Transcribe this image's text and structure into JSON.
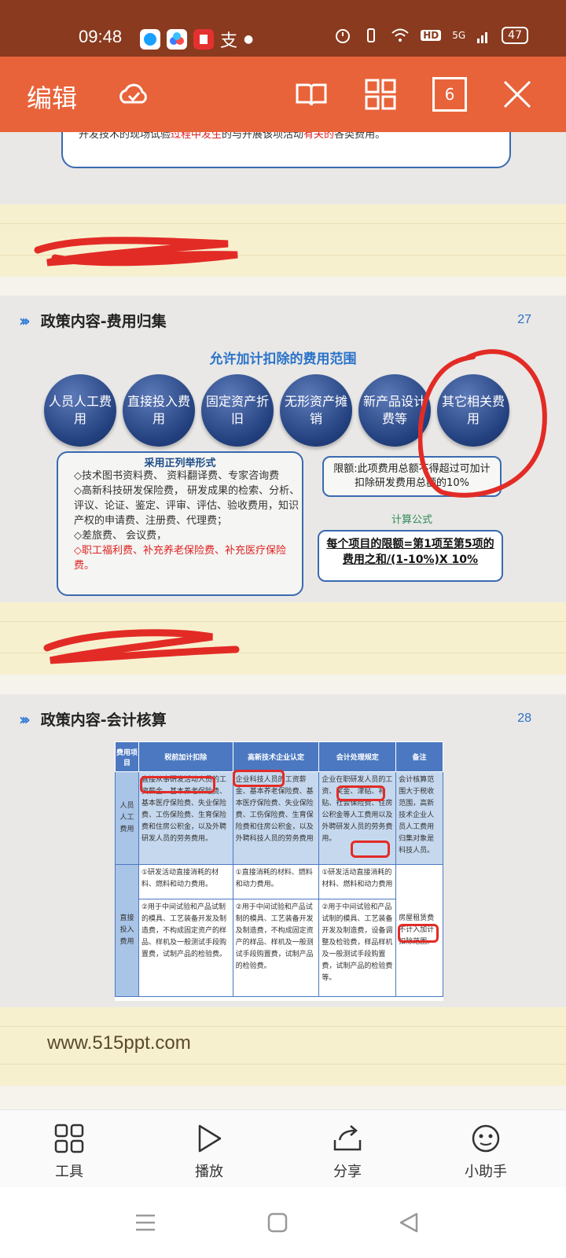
{
  "status": {
    "time": "09:48",
    "battery": "47",
    "signal": "5G",
    "hd": "HD",
    "app_icons": [
      "youku-icon",
      "baidu-netdisk-icon",
      "ting-icon",
      "zhi-icon"
    ],
    "app_label_zhi": "支"
  },
  "toolbar": {
    "edit_label": "编辑",
    "page_count": "6"
  },
  "slide_prev": {
    "fragment_pre": "开发技术的现场试验",
    "fragment_red1": "过程中发生",
    "fragment_mid": "的与开展该项活动",
    "fragment_red2": "有关的",
    "fragment_post": "各类费用。"
  },
  "slide27": {
    "title": "政策内容-费用归集",
    "number": "27",
    "subtitle": "允许加计扣除的费用范围",
    "circles": [
      "人员人工费用",
      "直接投入费用",
      "固定资产折旧",
      "无形资产摊销",
      "新产品设计费等",
      "其它相关费用"
    ],
    "list_title": "采用正列举形式",
    "list_items": [
      "◇技术图书资料费、 资料翻译费、专家咨询费",
      "◇高新科技研发保险费， 研发成果的检索、分析、评议、论证、鉴定、评审、评估、验收费用，知识产权的申请费、注册费、代理费；",
      "◇差旅费、 会议费，"
    ],
    "list_red_item": "◇职工福利费、补充养老保险费、补充医疗保险费。",
    "limit_text": "限额:此项费用总额不得超过可加计扣除研发费用总额的10%",
    "calc_label": "计算公式",
    "formula": "每个项目的限额=第1项至第5项的费用之和/(1-10%)X 10%"
  },
  "slide28": {
    "title": "政策内容-会计核算",
    "number": "28",
    "headers": [
      "费用项目",
      "税前加计扣除",
      "高新技术企业认定",
      "会计处理规定",
      "备注"
    ],
    "row1_label": "人员人工费用",
    "row1_cells": [
      "直接从事研发活动人员的工资薪金、基本养老保险费、基本医疗保险费、失业保险费、工伤保险费、生育保险费和住房公积金，以及外聘研发人员的劳务费用。",
      "企业科技人员的工资薪金、基本养老保险费、基本医疗保险费、失业保险费、工伤保险费、生育保险费和住房公积金，以及外聘科技人员的劳务费用",
      "企业在职研发人员的工资、奖金、津贴、补贴、社会保险费、住房公积金等人工费用以及外聘研发人员的劳务费用。",
      "会计核算范围大于税收范围，高新技术企业人员人工费用归集对象是科技人员。"
    ],
    "row2_label": "直接投入费用",
    "row2a_cells": [
      "①研发活动直接消耗的材料、燃料和动力费用。",
      "①直接消耗的材料、燃料和动力费用。",
      "①研发活动直接消耗的材料、燃料和动力费用"
    ],
    "row2b_cells": [
      "②用于中间试验和产品试制的模具、工艺装备开发及制造费，不构成固定资产的样品、样机及一般测试手段购置费，试制产品的检验费。",
      "②用于中间试验和产品试制的模具、工艺装备开发及制造费，不构成固定资产的样品、样机及一般测试手段购置费，试制产品的检验费。",
      "②用于中间试验和产品试制的模具、工艺装备开发及制造费，设备调整及检验费，样品样机及一般测试手段购置费，试制产品的检验费等。"
    ],
    "row2_note": "房屋租赁费不计入加计扣除范围。"
  },
  "watermark": "www.515ppt.com",
  "bottom_nav": {
    "tools": "工具",
    "play": "播放",
    "share": "分享",
    "assistant": "小助手"
  },
  "colors": {
    "status_bar": "#8a3a1e",
    "toolbar": "#e8633a",
    "note_band": "#f7f0cf",
    "slide_bg": "#e9e8e6",
    "accent_blue": "#2b73c9",
    "ink_red": "#e32b26"
  }
}
